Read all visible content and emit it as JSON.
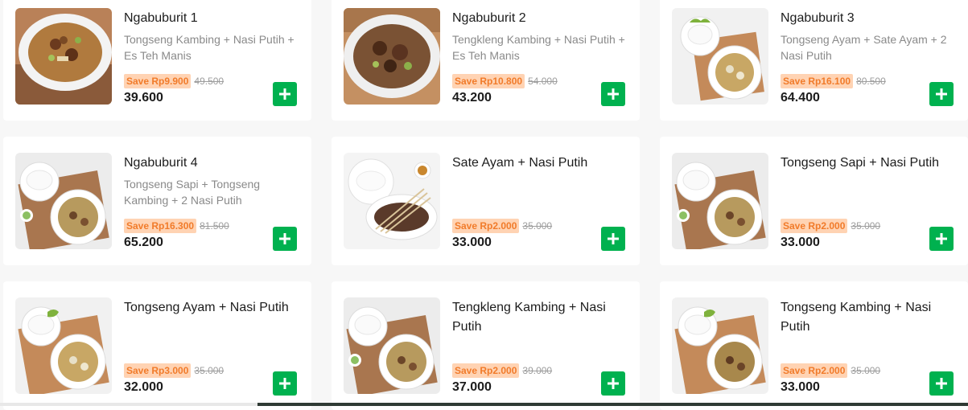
{
  "colors": {
    "accent": "#00b14f",
    "promo_bg": "#ffd3b3",
    "promo_text": "#f17b2a"
  },
  "items": [
    {
      "name": "Ngabuburit 1",
      "desc": "Tongseng Kambing + Nasi Putih + Es Teh Manis",
      "save": "Save Rp9.900",
      "original": "49.500",
      "price": "39.600",
      "photo": "tongseng-kambing-photo",
      "add_icon": "plus-icon"
    },
    {
      "name": "Ngabuburit 2",
      "desc": "Tengkleng Kambing + Nasi Putih + Es Teh Manis",
      "save": "Save Rp10.800",
      "original": "54.000",
      "price": "43.200",
      "photo": "tengkleng-kambing-photo",
      "add_icon": "plus-icon"
    },
    {
      "name": "Ngabuburit 3",
      "desc": "Tongseng Ayam + Sate Ayam + 2 Nasi Putih",
      "save": "Save Rp16.100",
      "original": "80.500",
      "price": "64.400",
      "photo": "tongseng-ayam-photo",
      "add_icon": "plus-icon"
    },
    {
      "name": "Ngabuburit 4",
      "desc": "Tongseng Sapi + Tongseng Kambing + 2 Nasi Putih",
      "save": "Save Rp16.300",
      "original": "81.500",
      "price": "65.200",
      "photo": "tongseng-sapi-photo",
      "add_icon": "plus-icon"
    },
    {
      "name": "Sate Ayam + Nasi Putih",
      "desc": "",
      "save": "Save Rp2.000",
      "original": "35.000",
      "price": "33.000",
      "photo": "sate-ayam-photo",
      "add_icon": "plus-icon"
    },
    {
      "name": "Tongseng Sapi + Nasi Putih",
      "desc": "",
      "save": "Save Rp2.000",
      "original": "35.000",
      "price": "33.000",
      "photo": "tongseng-sapi-photo",
      "add_icon": "plus-icon"
    },
    {
      "name": "Tongseng Ayam + Nasi Putih",
      "desc": "",
      "save": "Save Rp3.000",
      "original": "35.000",
      "price": "32.000",
      "photo": "tongseng-ayam-photo",
      "add_icon": "plus-icon"
    },
    {
      "name": "Tengkleng Kambing + Nasi Putih",
      "desc": "",
      "save": "Save Rp2.000",
      "original": "39.000",
      "price": "37.000",
      "photo": "tengkleng-kambing-photo",
      "add_icon": "plus-icon"
    },
    {
      "name": "Tongseng Kambing + Nasi Putih",
      "desc": "",
      "save": "Save Rp2.000",
      "original": "35.000",
      "price": "33.000",
      "photo": "tongseng-kambing-photo",
      "add_icon": "plus-icon"
    }
  ]
}
